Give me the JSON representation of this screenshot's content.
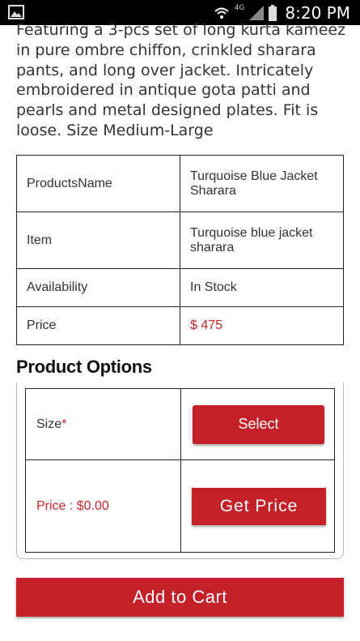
{
  "status_bar": {
    "time": "8:20 PM",
    "network": "4G"
  },
  "description": "Featuring a 3-pcs set of long kurta kameez in pure ombre chiffon, crinkled sharara pants, and long over jacket. Intricately embroidered in antique gota patti and pearls and metal designed plates. Fit is loose. Size Medium-Large",
  "info_table": [
    {
      "key": "ProductsName",
      "value": "Turquoise Blue Jacket Sharara"
    },
    {
      "key": "Item",
      "value": "Turquoise blue jacket sharara"
    },
    {
      "key": "Availability",
      "value": "In Stock"
    },
    {
      "key": "Price",
      "value": "$ 475"
    }
  ],
  "options": {
    "title": "Product Options",
    "size_label": "Size",
    "required_mark": "*",
    "select_label": "Select",
    "price_label": "Price : $0.00",
    "get_price_label": "Get Price"
  },
  "add_to_cart_label": "Add to Cart",
  "colors": {
    "accent": "#c4202a",
    "price": "#c9252b"
  }
}
